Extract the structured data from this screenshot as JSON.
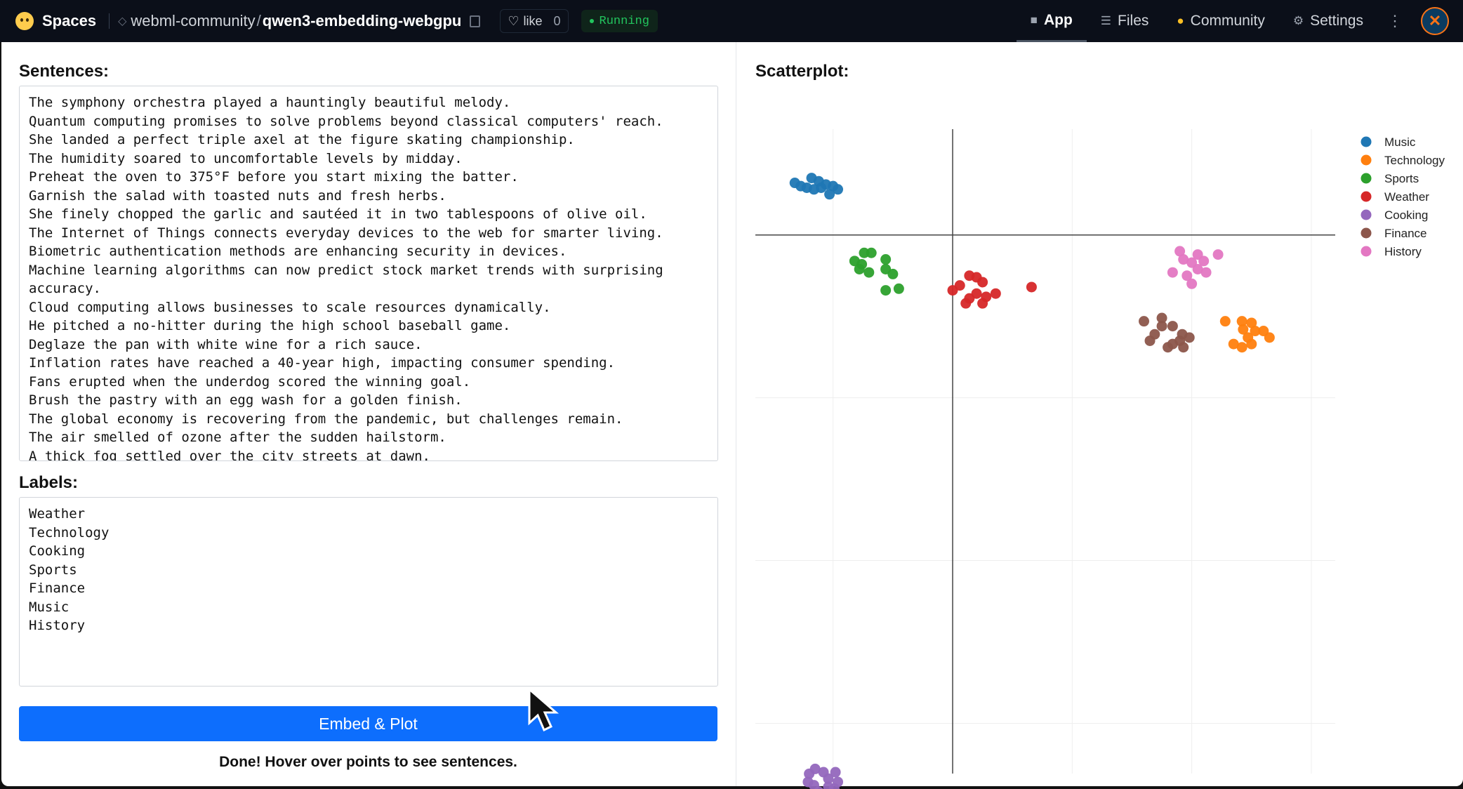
{
  "header": {
    "spaces_label": "Spaces",
    "org": "webml-community",
    "repo": "qwen3-embedding-webgpu",
    "like_label": "like",
    "like_count": "0",
    "status": "Running",
    "nav": [
      {
        "label": "App",
        "icon": "cube-icon",
        "active": true
      },
      {
        "label": "Files",
        "icon": "files-icon",
        "active": false
      },
      {
        "label": "Community",
        "icon": "community-icon",
        "active": false
      },
      {
        "label": "Settings",
        "icon": "gear-icon",
        "active": false
      }
    ]
  },
  "sentences": {
    "heading": "Sentences:",
    "lines": [
      "The symphony orchestra played a hauntingly beautiful melody.",
      "Quantum computing promises to solve problems beyond classical computers' reach.",
      "She landed a perfect triple axel at the figure skating championship.",
      "The humidity soared to uncomfortable levels by midday.",
      "Preheat the oven to 375°F before you start mixing the batter.",
      "Garnish the salad with toasted nuts and fresh herbs.",
      "She finely chopped the garlic and sautéed it in two tablespoons of olive oil.",
      "The Internet of Things connects everyday devices to the web for smarter living.",
      "Biometric authentication methods are enhancing security in devices.",
      "Machine learning algorithms can now predict stock market trends with surprising",
      "accuracy.",
      "Cloud computing allows businesses to scale resources dynamically.",
      "He pitched a no-hitter during the high school baseball game.",
      "Deglaze the pan with white wine for a rich sauce.",
      "Inflation rates have reached a 40-year high, impacting consumer spending.",
      "Fans erupted when the underdog scored the winning goal.",
      "Brush the pastry with an egg wash for a golden finish.",
      "The global economy is recovering from the pandemic, but challenges remain.",
      "The air smelled of ozone after the sudden hailstorm.",
      "A thick fog settled over the city streets at dawn."
    ]
  },
  "labels": {
    "heading": "Labels:",
    "lines": [
      "Weather",
      "Technology",
      "Cooking",
      "Sports",
      "Finance",
      "Music",
      "History"
    ]
  },
  "embed_button": "Embed & Plot",
  "status_message": "Done! Hover over points to see sentences.",
  "scatter": {
    "heading": "Scatterplot:"
  },
  "chart_data": {
    "type": "scatter",
    "title": "",
    "xlabel": "",
    "ylabel": "",
    "xlim": [
      -1.65,
      3.2
    ],
    "ylim": [
      -3.55,
      0.65
    ],
    "grid": true,
    "legend_position": "top-right",
    "series": [
      {
        "name": "Music",
        "color": "#1f77b4",
        "points": [
          [
            -1.32,
            0.32
          ],
          [
            -1.27,
            0.3
          ],
          [
            -1.18,
            0.35
          ],
          [
            -1.12,
            0.33
          ],
          [
            -1.1,
            0.29
          ],
          [
            -1.06,
            0.31
          ],
          [
            -1.0,
            0.3
          ],
          [
            -0.96,
            0.28
          ],
          [
            -1.03,
            0.25
          ],
          [
            -1.22,
            0.29
          ],
          [
            -1.16,
            0.28
          ]
        ]
      },
      {
        "name": "Technology",
        "color": "#ff7f0e",
        "points": [
          [
            2.28,
            -0.53
          ],
          [
            2.42,
            -0.53
          ],
          [
            2.5,
            -0.54
          ],
          [
            2.43,
            -0.58
          ],
          [
            2.53,
            -0.59
          ],
          [
            2.65,
            -0.63
          ],
          [
            2.5,
            -0.67
          ],
          [
            2.42,
            -0.69
          ],
          [
            2.35,
            -0.67
          ],
          [
            2.6,
            -0.59
          ],
          [
            2.47,
            -0.63
          ]
        ]
      },
      {
        "name": "Sports",
        "color": "#2ca02c",
        "points": [
          [
            -0.82,
            -0.16
          ],
          [
            -0.76,
            -0.18
          ],
          [
            -0.74,
            -0.11
          ],
          [
            -0.68,
            -0.11
          ],
          [
            -0.56,
            -0.15
          ],
          [
            -0.7,
            -0.23
          ],
          [
            -0.56,
            -0.21
          ],
          [
            -0.5,
            -0.24
          ],
          [
            -0.45,
            -0.33
          ],
          [
            -0.56,
            -0.34
          ],
          [
            -0.78,
            -0.21
          ]
        ]
      },
      {
        "name": "Weather",
        "color": "#d62728",
        "points": [
          [
            0.0,
            -0.34
          ],
          [
            0.06,
            -0.31
          ],
          [
            0.14,
            -0.25
          ],
          [
            0.2,
            -0.26
          ],
          [
            0.25,
            -0.29
          ],
          [
            0.2,
            -0.36
          ],
          [
            0.14,
            -0.39
          ],
          [
            0.28,
            -0.38
          ],
          [
            0.36,
            -0.36
          ],
          [
            0.25,
            -0.42
          ],
          [
            0.11,
            -0.42
          ],
          [
            0.66,
            -0.32
          ]
        ]
      },
      {
        "name": "Cooking",
        "color": "#9467bd",
        "points": [
          [
            -1.2,
            -3.31
          ],
          [
            -1.15,
            -3.28
          ],
          [
            -1.08,
            -3.3
          ],
          [
            -1.04,
            -3.34
          ],
          [
            -0.98,
            -3.3
          ],
          [
            -0.96,
            -3.36
          ],
          [
            -0.99,
            -3.4
          ],
          [
            -1.16,
            -3.38
          ],
          [
            -1.21,
            -3.36
          ],
          [
            -1.12,
            -3.42
          ],
          [
            -1.04,
            -3.39
          ]
        ]
      },
      {
        "name": "Finance",
        "color": "#8c564b",
        "points": [
          [
            1.6,
            -0.53
          ],
          [
            1.75,
            -0.51
          ],
          [
            1.75,
            -0.56
          ],
          [
            1.69,
            -0.61
          ],
          [
            1.65,
            -0.65
          ],
          [
            1.84,
            -0.56
          ],
          [
            1.9,
            -0.65
          ],
          [
            1.92,
            -0.61
          ],
          [
            1.98,
            -0.63
          ],
          [
            1.93,
            -0.69
          ],
          [
            1.8,
            -0.69
          ],
          [
            1.84,
            -0.67
          ]
        ]
      },
      {
        "name": "History",
        "color": "#e377c2",
        "points": [
          [
            1.9,
            -0.1
          ],
          [
            1.93,
            -0.15
          ],
          [
            2.0,
            -0.17
          ],
          [
            2.05,
            -0.12
          ],
          [
            2.1,
            -0.16
          ],
          [
            2.05,
            -0.21
          ],
          [
            1.96,
            -0.25
          ],
          [
            2.0,
            -0.3
          ],
          [
            2.12,
            -0.23
          ],
          [
            2.22,
            -0.12
          ],
          [
            1.84,
            -0.23
          ]
        ]
      }
    ]
  }
}
